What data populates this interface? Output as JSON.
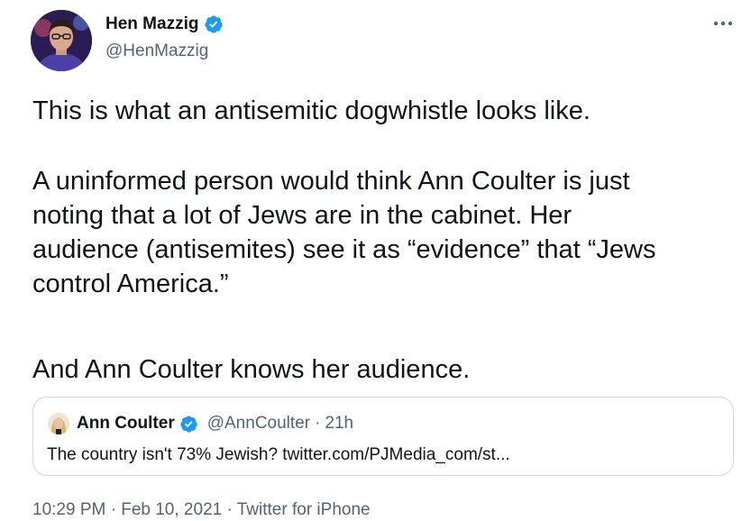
{
  "author": {
    "display_name": "Hen Mazzig",
    "handle": "@HenMazzig",
    "verified": true
  },
  "tweet": {
    "paragraph_1": "This is what an antisemitic dogwhistle looks like.",
    "paragraph_2": "A uninformed person would think Ann Coulter is just\nnoting that a lot of Jews are in the cabinet. Her\naudience (antisemites) see it as “evidence” that “Jews\ncontrol America.”",
    "paragraph_3": "And Ann Coulter knows her audience."
  },
  "quoted_tweet": {
    "display_name": "Ann Coulter",
    "verified": true,
    "handle": "@AnnCoulter",
    "separator": "·",
    "age": "21h",
    "text": "The country isn't 73% Jewish? twitter.com/PJMedia_com/st..."
  },
  "meta": {
    "time": "10:29 PM",
    "separator": " · ",
    "date": "Feb 10, 2021",
    "source": "Twitter for iPhone"
  },
  "icons": {
    "verified_badge": "verified-badge-icon",
    "more": "more-options-icon"
  },
  "colors": {
    "text": "#0f1419",
    "secondary_text": "#536471",
    "verified_blue": "#1d9bf0",
    "border": "#cfd9de"
  }
}
